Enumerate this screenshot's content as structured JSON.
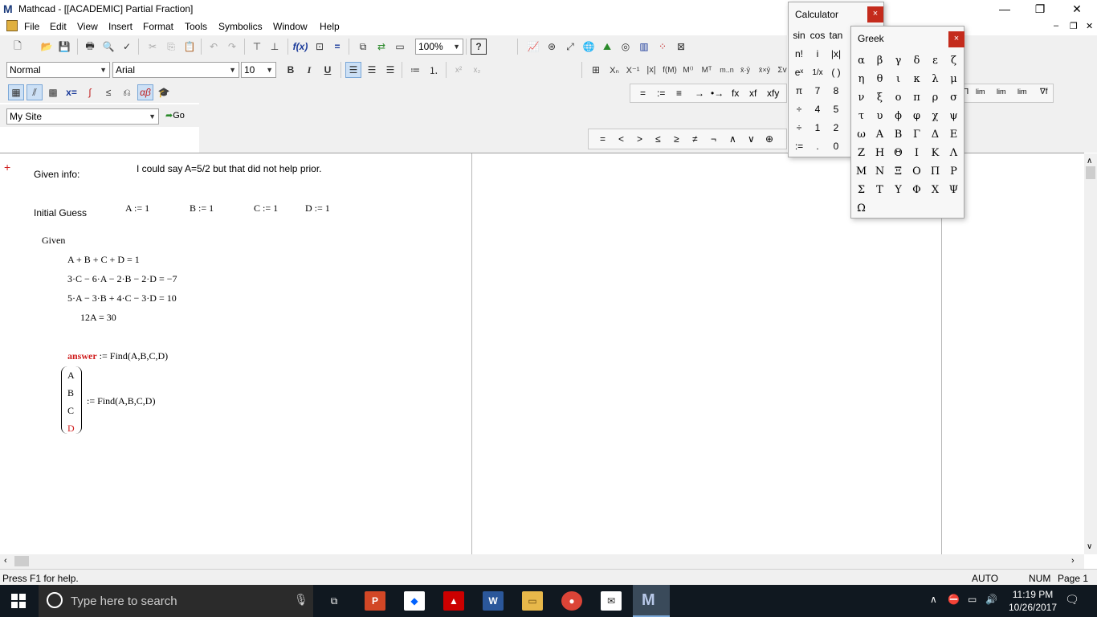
{
  "window": {
    "logo": "M",
    "title": "Mathcad - [[ACADEMIC] Partial Fraction]",
    "minimize": "—",
    "restore": "❐",
    "close": "✕",
    "inner_minimize": "–",
    "inner_restore": "❐",
    "inner_close": "✕"
  },
  "menu": [
    "File",
    "Edit",
    "View",
    "Insert",
    "Format",
    "Tools",
    "Symbolics",
    "Window",
    "Help"
  ],
  "toolbar": {
    "zoom": "100%",
    "style": "Normal",
    "font": "Arial",
    "size": "10",
    "bold": "B",
    "italic": "I",
    "underline": "U",
    "site": "My Site",
    "go": "Go"
  },
  "math_toolbar": {
    "ops": [
      "=",
      ":=",
      "≡",
      "→",
      "•→",
      "fx",
      "xf",
      "xfy"
    ],
    "relations": [
      "=",
      "<",
      ">",
      "≤",
      "≥",
      "≠",
      "¬",
      "∧",
      "∨",
      "⊕"
    ]
  },
  "document": {
    "given_info": "Given info:",
    "note": "I could say A=5/2 but that did not help prior.",
    "initial_guess": "Initial Guess",
    "guess_a": "A := 1",
    "guess_b": "B := 1",
    "guess_c": "C := 1",
    "guess_d": "D := 1",
    "given": "Given",
    "eq1": "A + B + C + D = 1",
    "eq2": "3·C − 6·A − 2·B − 2·D = −7",
    "eq3": "5·A − 3·B + 4·C − 3·D = 10",
    "eq4": "12A = 30",
    "answer_name": "answer",
    "answer_expr": ":= Find(A,B,C,D)",
    "vector": [
      "A",
      "B",
      "C",
      "D"
    ],
    "vector_expr": ":= Find(A,B,C,D)"
  },
  "status": {
    "help": "Press F1 for help.",
    "auto": "AUTO",
    "num": "NUM",
    "page": "Page 1"
  },
  "calculator": {
    "title": "Calculator",
    "close": "×",
    "rows": [
      [
        "sin",
        "cos",
        "tan"
      ],
      [
        "n!",
        "i",
        "|x|"
      ],
      [
        "eˣ",
        "1/x",
        "( )"
      ],
      [
        "π",
        "7",
        "8"
      ],
      [
        "÷",
        "4",
        "5"
      ],
      [
        "÷",
        "1",
        "2"
      ],
      [
        ":=",
        ".",
        "0"
      ]
    ]
  },
  "greek": {
    "title": "Greek",
    "close": "×",
    "rows": [
      [
        "α",
        "β",
        "γ",
        "δ",
        "ε",
        "ζ"
      ],
      [
        "η",
        "θ",
        "ι",
        "κ",
        "λ",
        "μ"
      ],
      [
        "ν",
        "ξ",
        "ο",
        "π",
        "ρ",
        "σ"
      ],
      [
        "τ",
        "υ",
        "ϕ",
        "φ",
        "χ",
        "ψ"
      ],
      [
        "ω",
        "Α",
        "Β",
        "Γ",
        "Δ",
        "Ε"
      ],
      [
        "Ζ",
        "Η",
        "Θ",
        "Ι",
        "Κ",
        "Λ"
      ],
      [
        "Μ",
        "Ν",
        "Ξ",
        "Ο",
        "Π",
        "Ρ"
      ],
      [
        "Σ",
        "Τ",
        "Υ",
        "Φ",
        "Χ",
        "Ψ"
      ],
      [
        "Ω"
      ]
    ]
  },
  "taskbar": {
    "search_placeholder": "Type here to search",
    "time": "11:19 PM",
    "date": "10/26/2017"
  }
}
